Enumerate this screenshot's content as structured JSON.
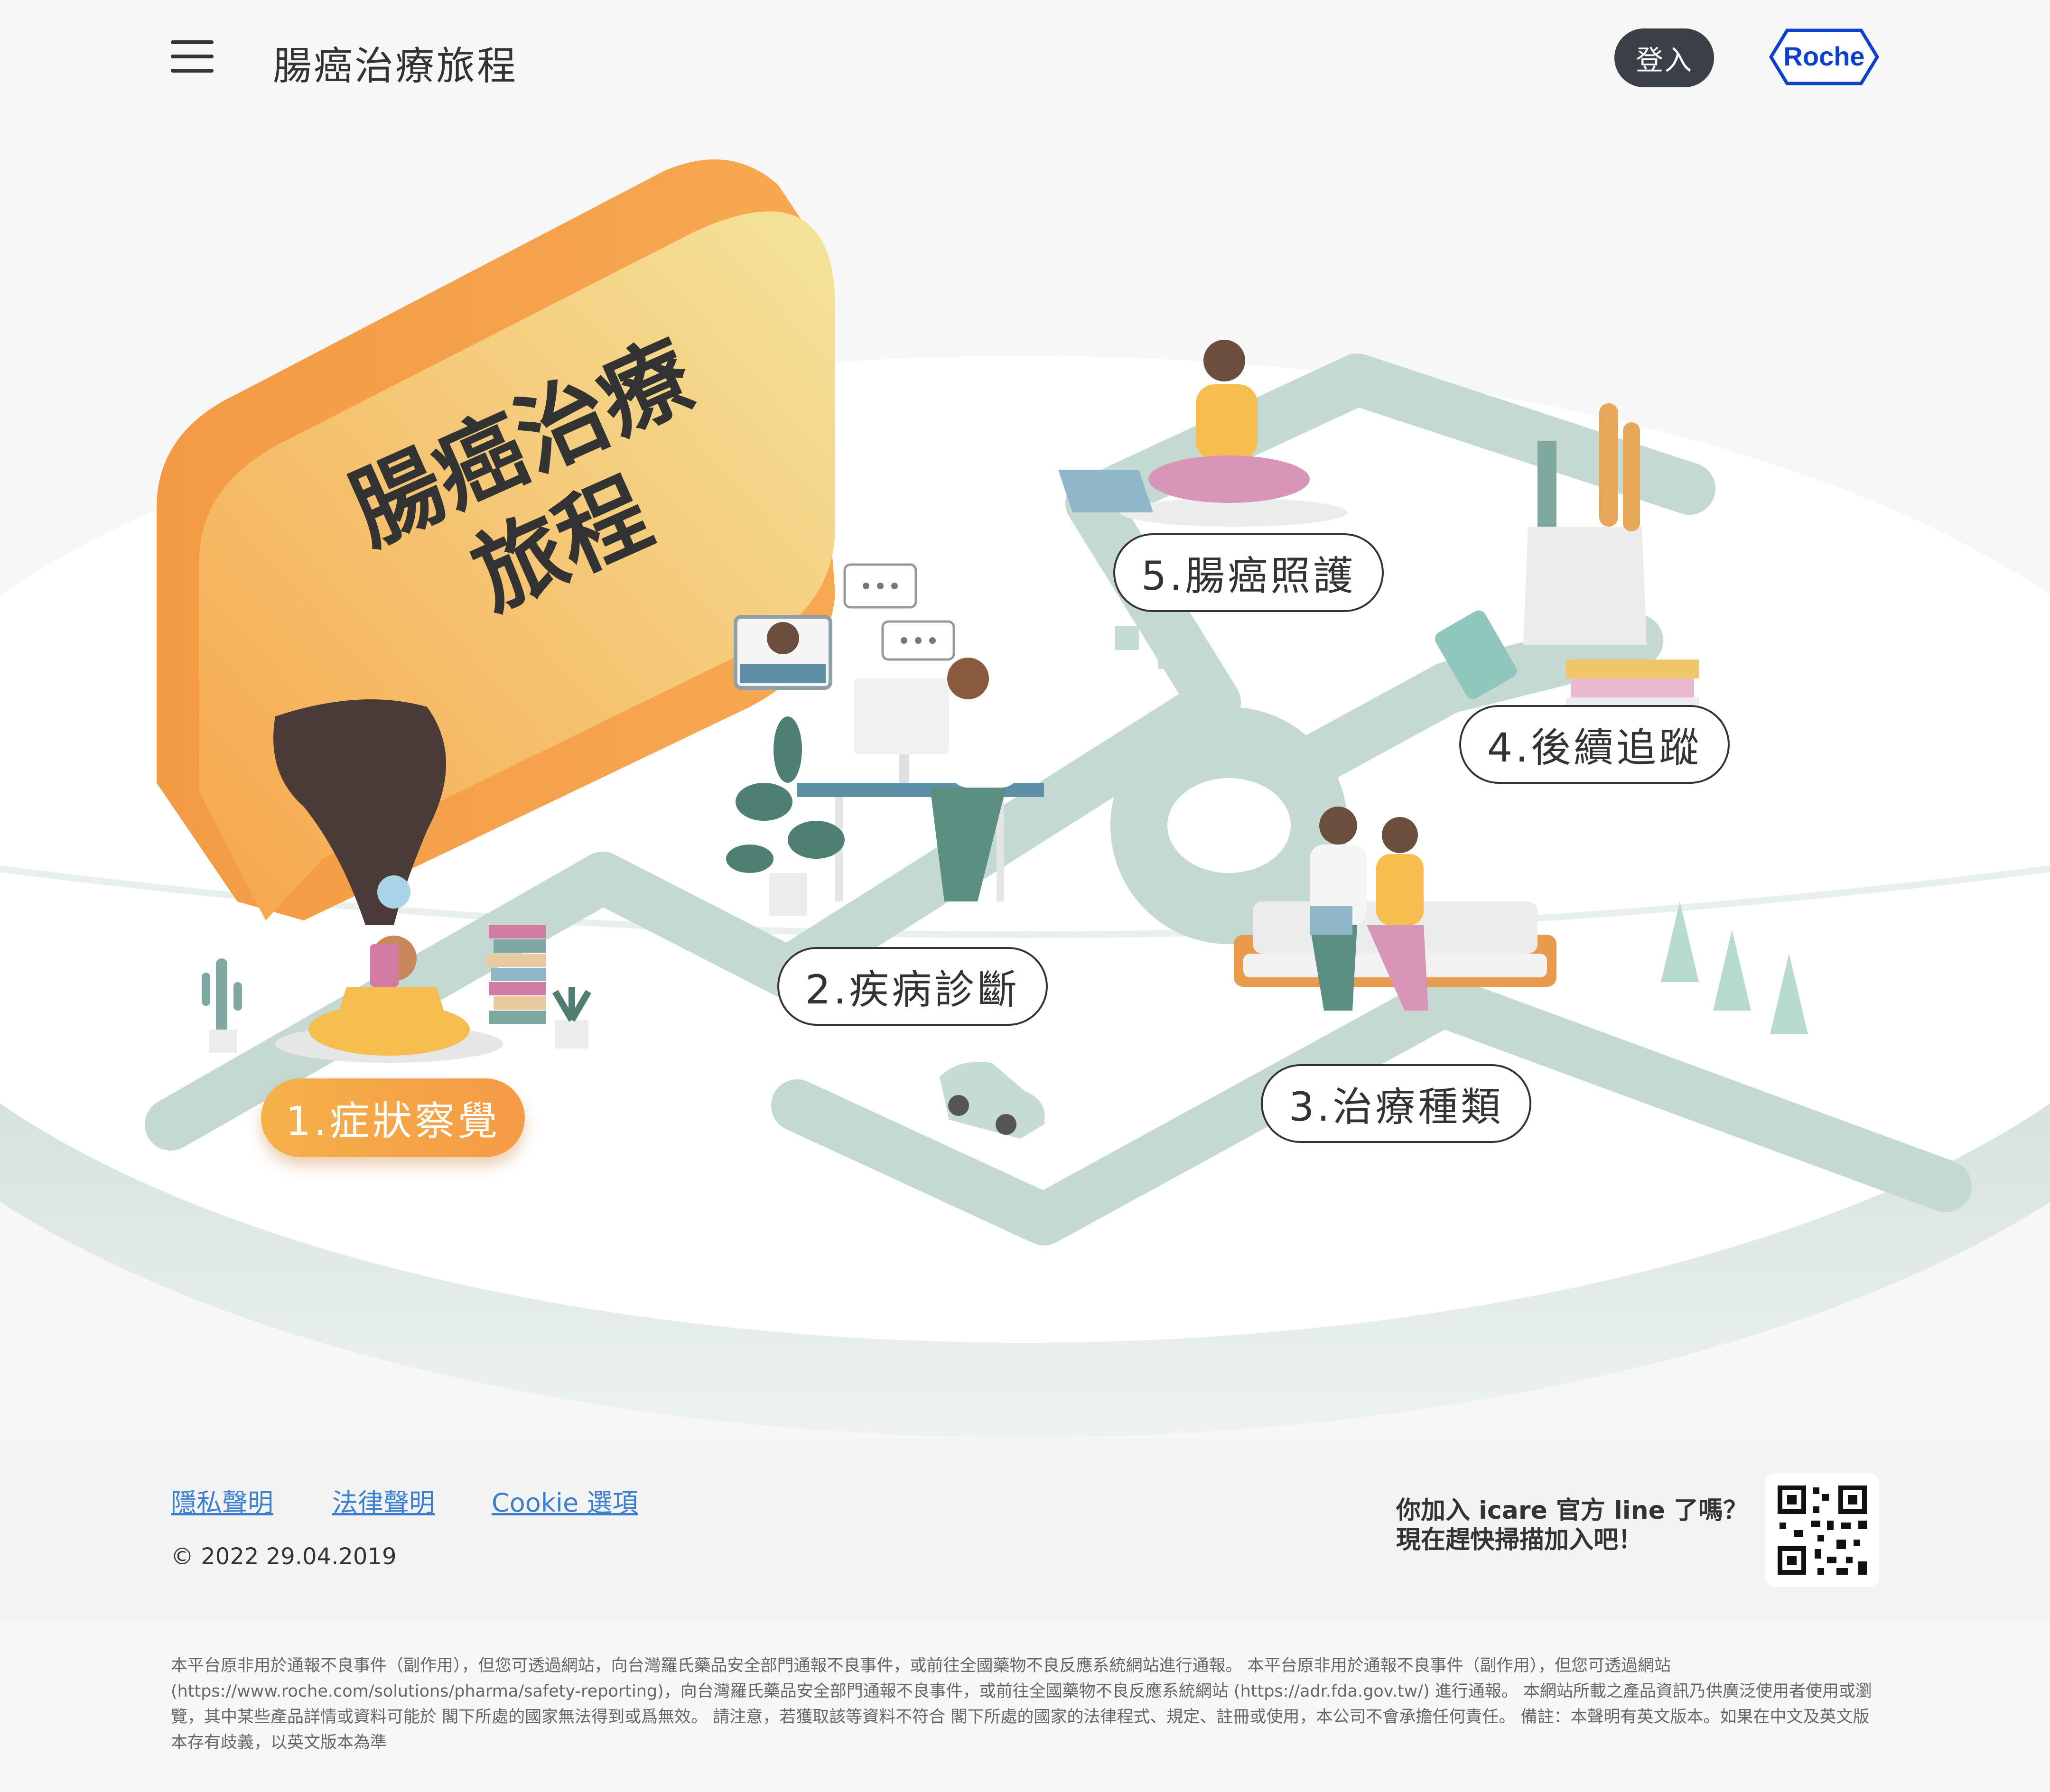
{
  "header": {
    "title": "腸癌治療旅程",
    "login_label": "登入",
    "logo_text": "Roche"
  },
  "hero": {
    "bubble_line1": "腸癌治療",
    "bubble_line2": "旅程",
    "steps": [
      {
        "label": "1.症狀察覺",
        "active": true
      },
      {
        "label": "2.疾病診斷",
        "active": false
      },
      {
        "label": "3.治療種類",
        "active": false
      },
      {
        "label": "4.後續追蹤",
        "active": false
      },
      {
        "label": "5.腸癌照護",
        "active": false
      }
    ]
  },
  "footer": {
    "links": [
      "隱私聲明",
      "法律聲明",
      "Cookie 選項"
    ],
    "copyright": "© 2022 29.04.2019",
    "line_text_1": "你加入 icare 官方 line 了嗎？",
    "line_text_2": "現在趕快掃描加入吧！"
  },
  "disclaimer": "本平台原非用於通報不良事件（副作用），但您可透過網站，向台灣羅氏藥品安全部門通報不良事件，或前往全國藥物不良反應系統網站進行通報。 本平台原非用於通報不良事件（副作用），但您可透過網站 (https://www.roche.com/solutions/pharma/safety-reporting)，向台灣羅氏藥品安全部門通報不良事件，或前往全國藥物不良反應系統網站 (https://adr.fda.gov.tw/) 進行通報。 本網站所載之產品資訊乃供廣泛使用者使用或瀏覽，其中某些產品詳情或資料可能於 閣下所處的國家無法得到或爲無效。 請注意，若獲取該等資料不符合 閣下所處的國家的法律程式、規定、註冊或使用，本公司不會承擔任何責任。 備註：本聲明有英文版本。如果在中文及英文版本存有歧義，以英文版本為準",
  "colors": {
    "accent_orange": "#f5a545",
    "path_green": "#b7cfc8",
    "dark_button": "#3b3f47",
    "link_blue": "#3b7fd0",
    "roche_blue": "#0b41cd"
  }
}
